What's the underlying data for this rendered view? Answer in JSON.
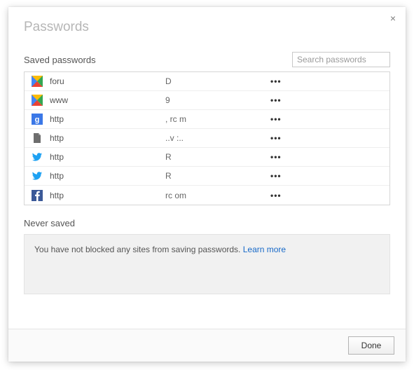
{
  "dialog": {
    "title": "Passwords",
    "close_glyph": "×"
  },
  "saved": {
    "label": "Saved passwords",
    "search_placeholder": "Search passwords",
    "rows": [
      {
        "icon": "google-multicolor",
        "site": "foru",
        "user": "D",
        "pw": "•••"
      },
      {
        "icon": "google-multicolor",
        "site": "www",
        "user": "9",
        "pw": "•••"
      },
      {
        "icon": "google-g",
        "site": "http",
        "user": ", rc   m",
        "pw": "•••"
      },
      {
        "icon": "file",
        "site": "http",
        "user": "..v    :..",
        "pw": "•••"
      },
      {
        "icon": "twitter",
        "site": "http",
        "user": "R",
        "pw": "•••"
      },
      {
        "icon": "twitter",
        "site": "http",
        "user": "R",
        "pw": "•••"
      },
      {
        "icon": "facebook",
        "site": "http",
        "user": "rc    om",
        "pw": "•••"
      }
    ]
  },
  "never": {
    "label": "Never saved",
    "message": "You have not blocked any sites from saving passwords. ",
    "link_text": "Learn more"
  },
  "footer": {
    "done_label": "Done"
  }
}
